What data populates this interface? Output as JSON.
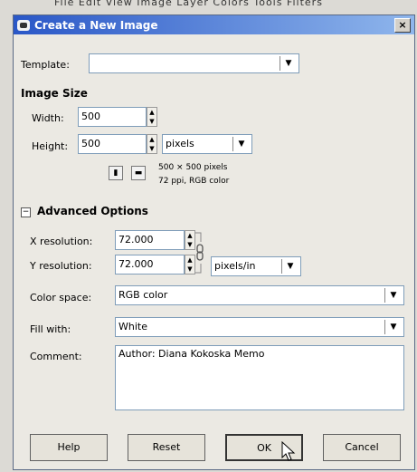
{
  "window": {
    "title": "Create a New Image",
    "close_label": "×"
  },
  "background": {
    "menu_hint": "File  Edit  View  Image  Layer  Colors  Tools  Filters"
  },
  "template": {
    "label": "Template:",
    "value": "",
    "arrow": "▼"
  },
  "image_size": {
    "title": "Image Size",
    "width_label": "Width:",
    "width_value": "500",
    "height_label": "Height:",
    "height_value": "500",
    "unit": "pixels",
    "unit_arrow": "▼",
    "info_line1": "500 × 500 pixels",
    "info_line2": "72 ppi, RGB color",
    "portrait_icon": "portrait-icon",
    "landscape_icon": "landscape-icon"
  },
  "advanced": {
    "expander": "−",
    "title": "Advanced Options",
    "xres_label": "X resolution:",
    "xres_value": "72.000",
    "yres_label": "Y resolution:",
    "yres_value": "72.000",
    "res_unit": "pixels/in",
    "res_unit_arrow": "▼",
    "colorspace_label": "Color space:",
    "colorspace_value": "RGB color",
    "fill_label": "Fill with:",
    "fill_value": "White",
    "comment_label": "Comment:",
    "comment_value": "Author: Diana Kokoska Memo",
    "dropdown_arrow": "▼"
  },
  "buttons": {
    "help": "Help",
    "reset": "Reset",
    "ok": "OK",
    "cancel": "Cancel"
  },
  "colors": {
    "titlebar_start": "#2a57c7",
    "titlebar_end": "#8fb6ec",
    "dialog_bg": "#ebe9e3"
  }
}
